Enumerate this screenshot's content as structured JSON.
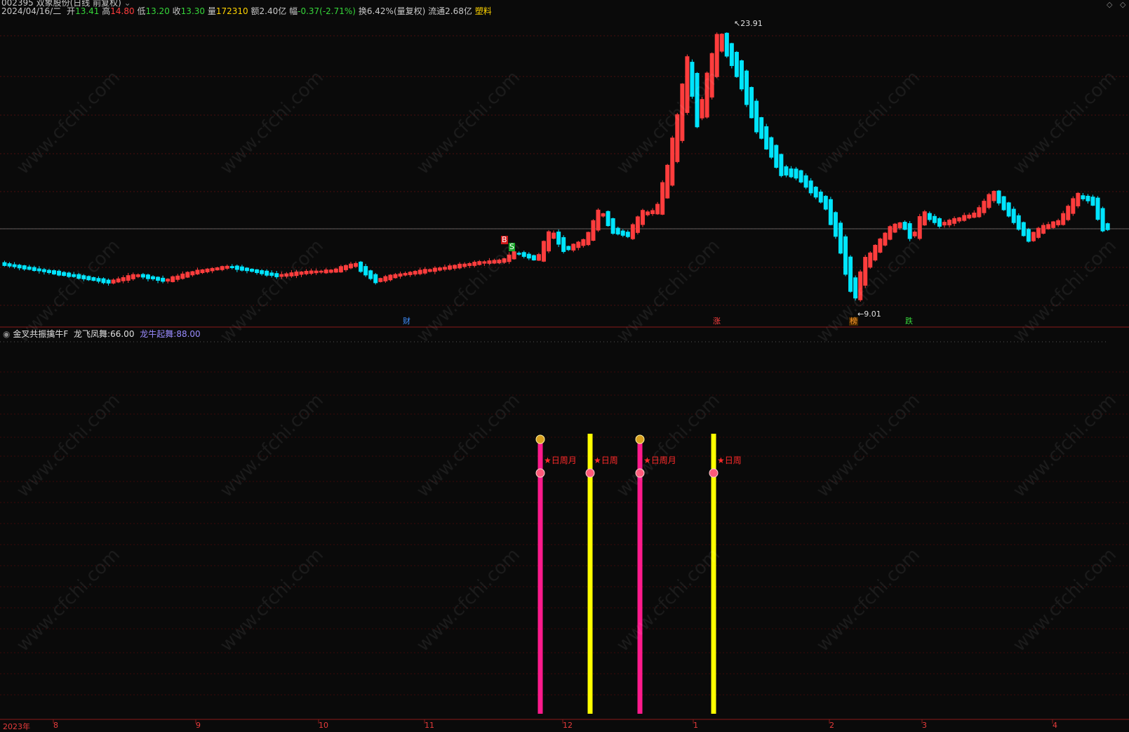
{
  "header": {
    "title": "002395 双象股份(日线 前复权)",
    "date": "2024/04/16/二",
    "open_label": "开",
    "open": "13.41",
    "high_label": "高",
    "high": "14.80",
    "low_label": "低",
    "low": "13.20",
    "close_label": "收",
    "close": "13.30",
    "volume_label": "量",
    "volume": "172310",
    "amount_label": "额",
    "amount": "2.40亿",
    "change_label": "幅",
    "change": "-0.37(-2.71%)",
    "turnover_label": "换",
    "turnover": "6.42%(量复权)",
    "float_label": "流通",
    "float": "2.68亿",
    "sector": "塑料"
  },
  "price_chart": {
    "high_marker": "23.91",
    "low_marker": "9.01",
    "signal_b": "B",
    "signal_s": "S",
    "tags": [
      {
        "text": "财",
        "color": "#3f8fff"
      },
      {
        "text": "涨",
        "color": "#ff4040"
      },
      {
        "text": "榜",
        "color": "#ff9a2a"
      },
      {
        "text": "跌",
        "color": "#36d63a"
      }
    ]
  },
  "indicator": {
    "name": "金叉共振擒牛F",
    "item1_label": "龙飞凤舞:",
    "item1_value": "66.00",
    "item2_label": "龙牛起舞:",
    "item2_value": "88.00",
    "bar_labels": [
      "★日周月",
      "★日周",
      "★日周月",
      "★日周"
    ],
    "colors": {
      "pink": "#ff1a8c",
      "yellow": "#ffff00"
    }
  },
  "time_axis": {
    "labels": [
      "2023年",
      "8",
      "9",
      "10",
      "11",
      "12",
      "1",
      "2",
      "3",
      "4"
    ]
  },
  "watermark": "www.cfchi.com",
  "colors": {
    "up": "#ff3d3d",
    "down": "#00e5ff",
    "grid": "#5a0f0f",
    "background": "#0a0a0a"
  }
}
